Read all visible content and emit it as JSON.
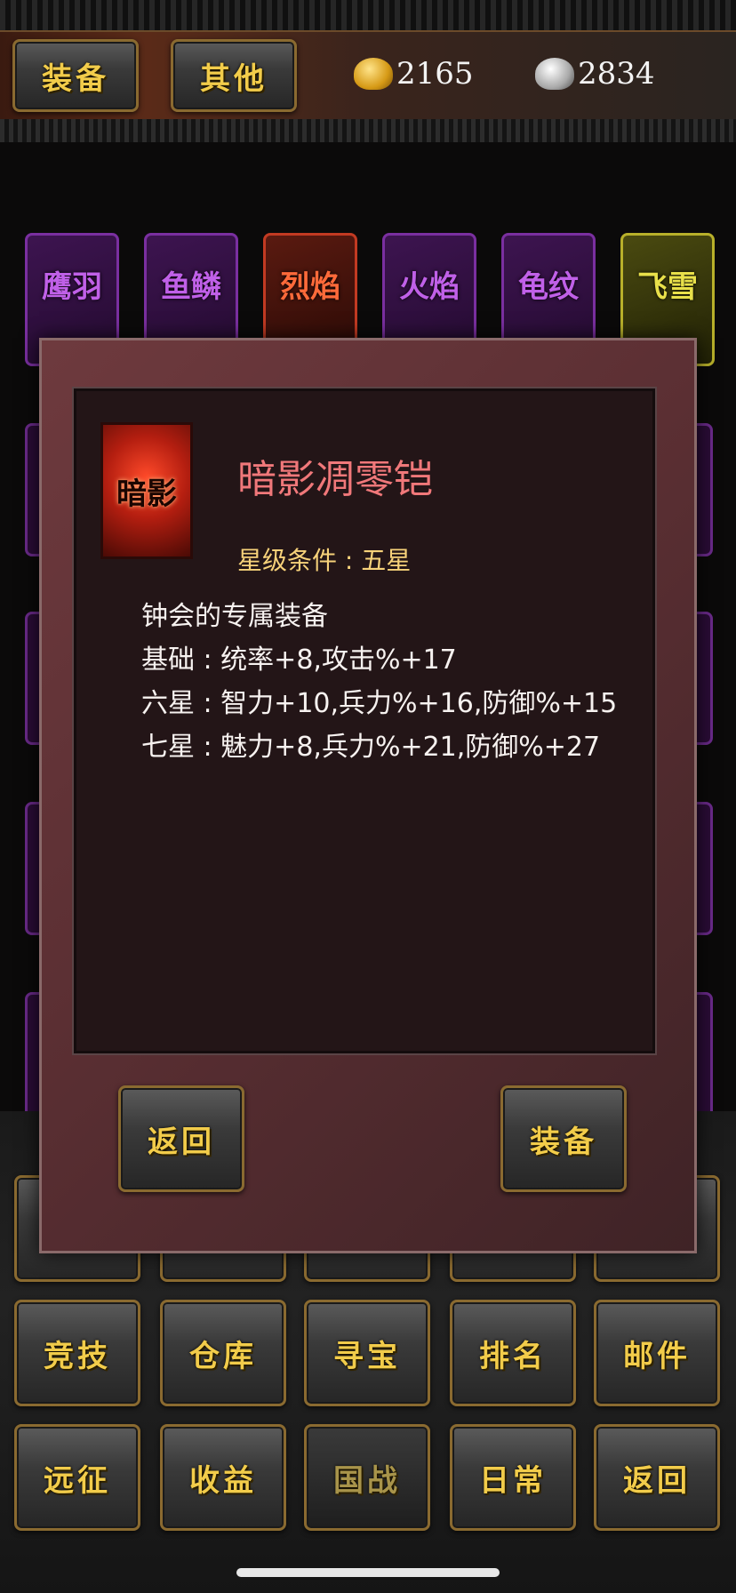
{
  "top_bar": {
    "tabs": [
      "装备",
      "其他"
    ],
    "gold_amount": "2165",
    "silver_amount": "2834",
    "gold_icon": "gold-ingot-icon",
    "silver_icon": "silver-ingot-icon"
  },
  "equipment_grid": {
    "row1": [
      {
        "label": "鹰羽",
        "color": "purple"
      },
      {
        "label": "鱼鳞",
        "color": "purple"
      },
      {
        "label": "烈焰",
        "color": "red"
      },
      {
        "label": "火焰",
        "color": "purple"
      },
      {
        "label": "龟纹",
        "color": "purple"
      },
      {
        "label": "飞雪",
        "color": "yellow"
      }
    ]
  },
  "modal": {
    "item_icon_label": "暗影",
    "item_name": "暗影凋零铠",
    "star_requirement": "星级条件 : 五星",
    "description": [
      "钟会的专属装备",
      "基础 : 统率+8,攻击%+17",
      "六星 : 智力+10,兵力%+16,防御%+15",
      "七星 : 魅力+8,兵力%+21,防御%+27"
    ],
    "back_button": "返回",
    "equip_button": "装备"
  },
  "bottom_nav": {
    "row2": [
      "竞技",
      "仓库",
      "寻宝",
      "排名",
      "邮件"
    ],
    "row3": [
      "远征",
      "收益",
      "国战",
      "日常",
      "返回"
    ]
  },
  "colors": {
    "accent_gold": "#f2cc4a",
    "item_name": "#f0787a",
    "modal_bg": "#5b2f33"
  }
}
